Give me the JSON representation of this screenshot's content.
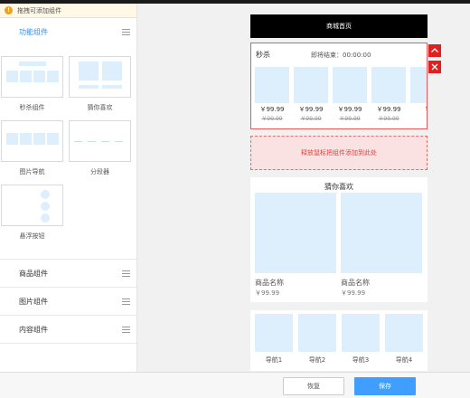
{
  "tip": {
    "icon": "warning-icon",
    "text": "拖拽可添加组件"
  },
  "sidebar": {
    "sections": [
      {
        "label": "功能组件",
        "active": true
      },
      {
        "label": "商品组件",
        "active": false
      },
      {
        "label": "图片组件",
        "active": false
      },
      {
        "label": "内容组件",
        "active": false
      }
    ],
    "components": [
      {
        "label": "秒杀组件"
      },
      {
        "label": "猜你喜欢"
      },
      {
        "label": "图片导航"
      },
      {
        "label": "分段器"
      },
      {
        "label": "悬浮按钮"
      }
    ]
  },
  "preview": {
    "header_title": "商城首页",
    "seckill": {
      "title": "秒杀",
      "countdown": "即将结束：00:00:00",
      "items": [
        {
          "price": "￥99.99",
          "old_price": "￥99.99"
        },
        {
          "price": "￥99.99",
          "old_price": "￥99.99"
        },
        {
          "price": "￥99.99",
          "old_price": "￥99.99"
        },
        {
          "price": "￥99.99",
          "old_price": "￥99.99"
        },
        {
          "price": "￥",
          "old_price": ""
        }
      ]
    },
    "side_controls": {
      "up_icon": "chevron-up-icon",
      "close_icon": "close-icon"
    },
    "drop_zone_text": "释放鼠标把组件添加到此处",
    "guess": {
      "title": "猜你喜欢",
      "items": [
        {
          "name": "商品名称",
          "price": "￥99.99"
        },
        {
          "name": "商品名称",
          "price": "￥99.99"
        }
      ]
    },
    "nav": {
      "items": [
        {
          "label": "导航1"
        },
        {
          "label": "导航2"
        },
        {
          "label": "导航3"
        },
        {
          "label": "导航4"
        }
      ]
    }
  },
  "footer": {
    "restore_label": "恢复",
    "save_label": "保存"
  },
  "colors": {
    "accent": "#409eff",
    "danger": "#e02020",
    "placeholder": "#ddeefc"
  }
}
